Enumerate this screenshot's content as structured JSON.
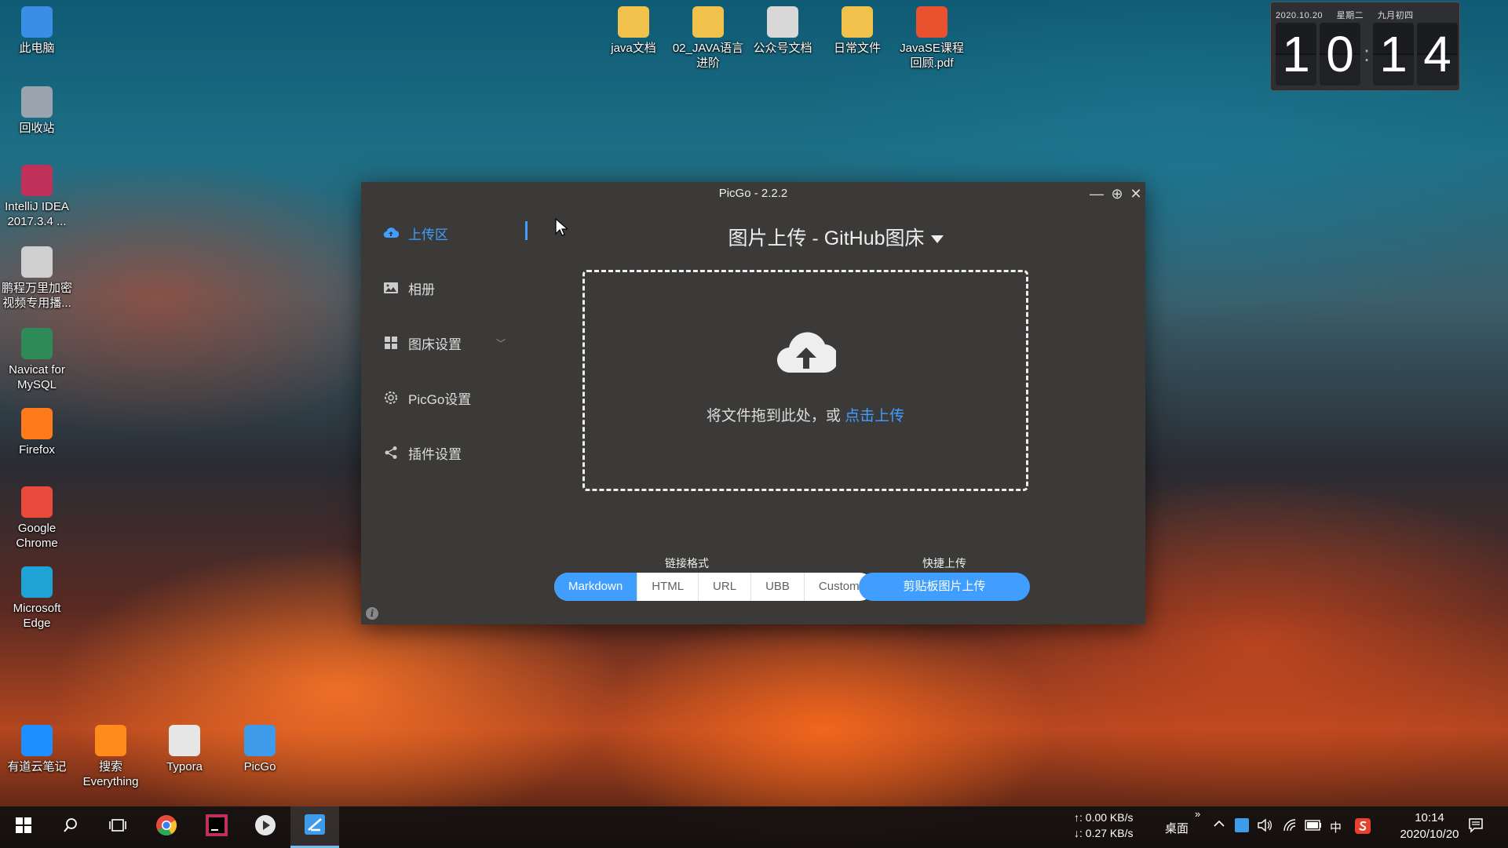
{
  "desktop": {
    "left_icons": [
      {
        "label": "此电脑",
        "color": "#3a8ee6"
      },
      {
        "label": "回收站",
        "color": "#9aa4ae"
      },
      {
        "label": "IntelliJ IDEA 2017.3.4 ...",
        "color": "#c0305a"
      },
      {
        "label": "鹏程万里加密视频专用播...",
        "color": "#cfcfcf"
      },
      {
        "label": "Navicat for MySQL",
        "color": "#2e8b57"
      },
      {
        "label": "Firefox",
        "color": "#ff7a1a"
      },
      {
        "label": "Google Chrome",
        "color": "#e84b3c"
      },
      {
        "label": "Microsoft Edge",
        "color": "#1fa2d6"
      }
    ],
    "top_icons": [
      {
        "label": "java文档",
        "color": "#f0c24b"
      },
      {
        "label": "02_JAVA语言进阶",
        "color": "#f0c24b"
      },
      {
        "label": "公众号文档",
        "color": "#d8d8d8"
      },
      {
        "label": "日常文件",
        "color": "#f0c24b"
      },
      {
        "label": "JavaSE课程回顾.pdf",
        "color": "#e8522f"
      }
    ],
    "bottom_icons": [
      {
        "label": "有道云笔记",
        "color": "#1e8fff"
      },
      {
        "label": "搜索 Everything",
        "color": "#ff8c1a"
      },
      {
        "label": "Typora",
        "color": "#e6e6e6"
      },
      {
        "label": "PicGo",
        "color": "#3d9be9"
      }
    ]
  },
  "clock": {
    "date": "2020.10.20",
    "weekday": "星期二",
    "lunar": "九月初四",
    "digits": [
      "1",
      "0",
      "1",
      "4"
    ],
    "colon": ":"
  },
  "window": {
    "title": "PicGo - 2.2.2",
    "minimize": "—",
    "maximize": "⊕",
    "close": "✕",
    "accent": "#409eff",
    "nav": [
      {
        "label": "上传区",
        "icon": "cloud-upload-icon"
      },
      {
        "label": "相册",
        "icon": "picture-icon"
      },
      {
        "label": "图床设置",
        "icon": "grid-icon",
        "has_chevron": true
      },
      {
        "label": "PicGo设置",
        "icon": "gear-icon"
      },
      {
        "label": "插件设置",
        "icon": "share-icon"
      }
    ],
    "chevron": "﹀",
    "upload_title": "图片上传 - GitHub图床",
    "drop_hint": "将文件拖到此处，或 ",
    "drop_link": "点击上传",
    "link_format_label": "链接格式",
    "link_formats": [
      "Markdown",
      "HTML",
      "URL",
      "UBB",
      "Custom"
    ],
    "active_format": "Markdown",
    "quick_upload_label": "快捷上传",
    "quick_upload_button": "剪贴板图片上传",
    "info": "i"
  },
  "taskbar": {
    "net_up": "↑: 0.00 KB/s",
    "net_down": "↓: 0.27 KB/s",
    "desktop_label": "桌面",
    "expand": "»",
    "ime": "中",
    "time": "10:14",
    "date": "2020/10/20"
  }
}
